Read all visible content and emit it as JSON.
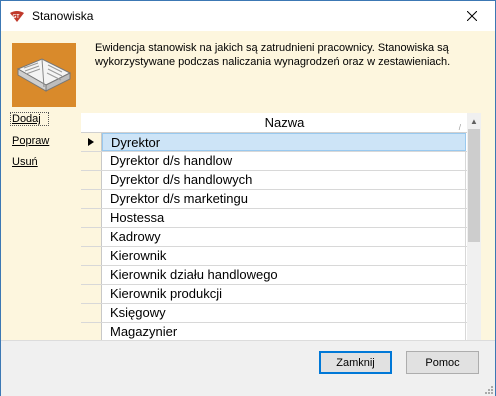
{
  "window": {
    "title": "Stanowiska",
    "app_icon": "gt-logo-icon",
    "close_icon": "close-icon"
  },
  "header": {
    "icon": "open-book-icon",
    "description": "Ewidencja stanowisk na jakich są zatrudnieni pracownicy. Stanowiska są wykorzystywane podczas naliczania wynagrodzeń oraz w zestawieniach."
  },
  "side_links": [
    {
      "label": "Dodaj"
    },
    {
      "label": "Popraw"
    },
    {
      "label": "Usuń"
    }
  ],
  "grid": {
    "column_header": "Nazwa",
    "selected_index": 0,
    "rows": [
      {
        "name": "Dyrektor"
      },
      {
        "name": "Dyrektor d/s handlow"
      },
      {
        "name": "Dyrektor d/s handlowych"
      },
      {
        "name": "Dyrektor d/s marketingu"
      },
      {
        "name": "Hostessa"
      },
      {
        "name": "Kadrowy"
      },
      {
        "name": "Kierownik"
      },
      {
        "name": "Kierownik działu handlowego"
      },
      {
        "name": "Kierownik produkcji"
      },
      {
        "name": "Księgowy"
      },
      {
        "name": "Magazynier"
      }
    ]
  },
  "footer": {
    "close_label": "Zamknij",
    "help_label": "Pomoc"
  },
  "colors": {
    "content_bg": "#fdf6de",
    "selection_bg": "#cde4f7",
    "window_border": "#3c78b4",
    "default_button_border": "#0078d7"
  }
}
